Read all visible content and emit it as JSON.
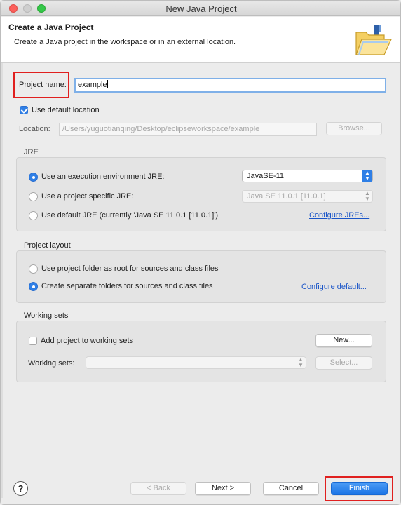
{
  "window": {
    "title": "New Java Project",
    "controls": [
      "close",
      "minimize",
      "zoom"
    ]
  },
  "header": {
    "title": "Create a Java Project",
    "description": "Create a Java project in the workspace or in an external location.",
    "icon": "java-project-folder-icon"
  },
  "project": {
    "name_label": "Project name:",
    "name_value": "example",
    "use_default_location_label": "Use default location",
    "use_default_location_checked": true,
    "location_label": "Location:",
    "location_value": "/Users/yuguotianqing/Desktop/eclipseworkspace/example",
    "browse_label": "Browse..."
  },
  "jre": {
    "section_label": "JRE",
    "options": [
      {
        "label": "Use an execution environment JRE:",
        "selected": true
      },
      {
        "label": "Use a project specific JRE:",
        "selected": false
      },
      {
        "label": "Use default JRE (currently 'Java SE 11.0.1 [11.0.1]')",
        "selected": false
      }
    ],
    "execution_env_value": "JavaSE-11",
    "project_specific_value": "Java SE 11.0.1 [11.0.1]",
    "configure_link": "Configure JREs..."
  },
  "layout": {
    "section_label": "Project layout",
    "options": [
      {
        "label": "Use project folder as root for sources and class files",
        "selected": false
      },
      {
        "label": "Create separate folders for sources and class files",
        "selected": true
      }
    ],
    "configure_link": "Configure default..."
  },
  "working_sets": {
    "section_label": "Working sets",
    "add_label": "Add project to working sets",
    "add_checked": false,
    "new_label": "New...",
    "sets_label": "Working sets:",
    "sets_value": "",
    "select_label": "Select..."
  },
  "footer": {
    "help": "?",
    "back_label": "< Back",
    "next_label": "Next >",
    "cancel_label": "Cancel",
    "finish_label": "Finish"
  },
  "colors": {
    "accent": "#2f7fe6",
    "link": "#1a55c8",
    "annotation": "#e0201f"
  }
}
